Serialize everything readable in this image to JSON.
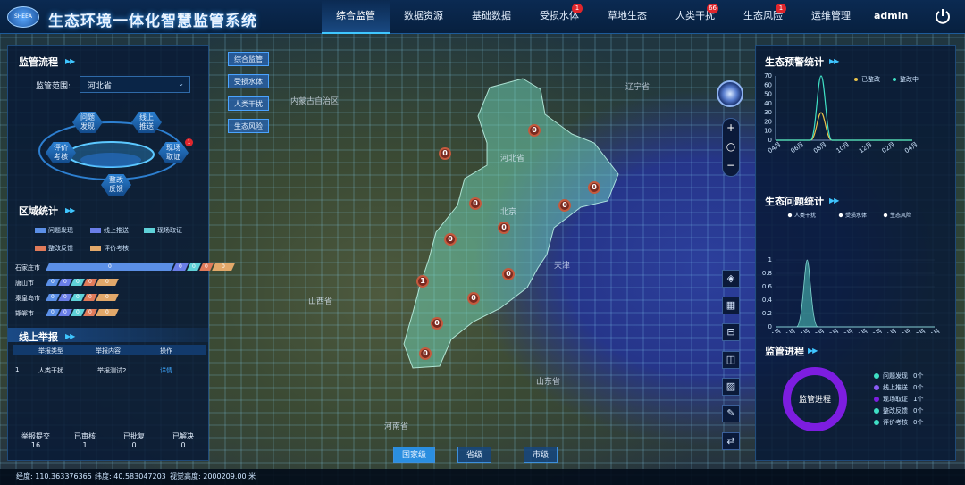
{
  "header": {
    "logo_text": "SHEEA",
    "title": "生态环境一体化智慧监管系统",
    "user": "admin",
    "nav": [
      {
        "label": "综合监管",
        "badge": ""
      },
      {
        "label": "数据资源",
        "badge": ""
      },
      {
        "label": "基础数据",
        "badge": ""
      },
      {
        "label": "受损水体",
        "badge": "1"
      },
      {
        "label": "草地生态",
        "badge": ""
      },
      {
        "label": "人类干扰",
        "badge": "66"
      },
      {
        "label": "生态风险",
        "badge": "1"
      },
      {
        "label": "运维管理",
        "badge": ""
      }
    ]
  },
  "left": {
    "process_title": "监管流程",
    "scope_label": "监管范围:",
    "scope_value": "河北省",
    "process_nodes": [
      {
        "label": "问题\n发现"
      },
      {
        "label": "线上\n推送"
      },
      {
        "label": "评价\n考核"
      },
      {
        "label": "现场\n取证",
        "badge": "1"
      },
      {
        "label": "整改\n反馈"
      }
    ],
    "region_title": "区域统计",
    "legend": [
      {
        "label": "问题发现",
        "color": "#5b8fe6"
      },
      {
        "label": "线上推送",
        "color": "#6a7ee8"
      },
      {
        "label": "现场取证",
        "color": "#5fd1d8"
      },
      {
        "label": "整改反馈",
        "color": "#e07b5a"
      },
      {
        "label": "评价考核",
        "color": "#e2a86a"
      }
    ],
    "region_rows": [
      {
        "name": "石家庄市",
        "segs": [
          "0",
          "0",
          "0",
          "0",
          "0"
        ]
      },
      {
        "name": "唐山市",
        "segs": [
          "0",
          "0",
          "0",
          "0",
          "0"
        ]
      },
      {
        "name": "秦皇岛市",
        "segs": [
          "0",
          "0",
          "0",
          "0",
          "0"
        ]
      },
      {
        "name": "邯郸市",
        "segs": [
          "0",
          "0",
          "0",
          "0",
          "0"
        ]
      }
    ],
    "report_title": "线上举报",
    "report_headers": [
      "举报类型",
      "举报内容",
      "操作"
    ],
    "report_rows": [
      {
        "index": "1",
        "type": "人类干扰",
        "content": "举报测试2",
        "action": "详情"
      }
    ],
    "stats": [
      {
        "label": "举报提交",
        "value": "16"
      },
      {
        "label": "已审核",
        "value": "1"
      },
      {
        "label": "已批复",
        "value": "0"
      },
      {
        "label": "已解决",
        "value": "0"
      }
    ]
  },
  "map": {
    "side_tabs": [
      "综合监管",
      "受损水体",
      "人类干扰",
      "生态风险"
    ],
    "labels": [
      "内蒙古自治区",
      "河北省",
      "北京",
      "天津",
      "山西省",
      "山东省",
      "河南省",
      "辽宁省"
    ],
    "counts": [
      "0",
      "0",
      "0",
      "0",
      "0",
      "0",
      "0",
      "0",
      "1",
      "0",
      "0",
      "0",
      "0"
    ],
    "level_tabs": [
      "国家级",
      "省级",
      "市级"
    ],
    "zoom": [
      "+",
      "○",
      "−"
    ],
    "tools": [
      {
        "name": "layers-icon",
        "glyph": "◈"
      },
      {
        "name": "grid-icon",
        "glyph": "▦"
      },
      {
        "name": "measure-icon",
        "glyph": "⊟"
      },
      {
        "name": "split-icon",
        "glyph": "◫"
      },
      {
        "name": "hatch-icon",
        "glyph": "▨"
      },
      {
        "name": "draw-icon",
        "glyph": "✎"
      },
      {
        "name": "swap-icon",
        "glyph": "⇄"
      }
    ]
  },
  "status": {
    "lon": "经度: 110.363376365",
    "lat": "纬度: 40.583047203",
    "alt": "视觉高度: 2000209.00 米"
  },
  "right": {
    "warn_title": "生态预警统计",
    "issue_title": "生态问题统计",
    "progress_title": "监管进程",
    "donut_text": "监管进程",
    "progress_items": [
      {
        "label": "问题发现",
        "value": "0个",
        "color": "#3fe0c5"
      },
      {
        "label": "线上推送",
        "value": "0个",
        "color": "#8b5cf6"
      },
      {
        "label": "现场取证",
        "value": "1个",
        "color": "#7d1de0"
      },
      {
        "label": "整改反馈",
        "value": "0个",
        "color": "#3fe0c5"
      },
      {
        "label": "评价考核",
        "value": "0个",
        "color": "#3fe0c5"
      }
    ]
  },
  "chart_data": [
    {
      "type": "line",
      "title": "生态预警统计",
      "categories": [
        "04月",
        "06月",
        "08月",
        "10月",
        "12月",
        "02月",
        "04月"
      ],
      "series": [
        {
          "name": "已整改",
          "color": "#e8c24a",
          "values": [
            0,
            0,
            30,
            0,
            0,
            0,
            0
          ]
        },
        {
          "name": "整改中",
          "color": "#3fe0c5",
          "values": [
            0,
            0,
            70,
            0,
            0,
            0,
            0
          ]
        }
      ],
      "ylim": [
        0,
        70
      ],
      "yticks": [
        0,
        10,
        20,
        30,
        40,
        50,
        60,
        70
      ]
    },
    {
      "type": "area",
      "title": "生态问题统计",
      "categories": [
        "04月",
        "05月",
        "07月",
        "08月",
        "09月",
        "10月",
        "11月",
        "12月",
        "01月",
        "02月",
        "03月",
        "04月"
      ],
      "series": [
        {
          "name": "人类干扰",
          "color": "#ffffff",
          "values": [
            0,
            0,
            1,
            0,
            0,
            0,
            0,
            0,
            0,
            0,
            0,
            0
          ]
        },
        {
          "name": "受损水体",
          "color": "#ffffff",
          "values": [
            0,
            0,
            0,
            0,
            0,
            0,
            0,
            0,
            0,
            0,
            0,
            0
          ]
        },
        {
          "name": "生态风险",
          "color": "#ffffff",
          "values": [
            0,
            0,
            0,
            0,
            0,
            0,
            0,
            0,
            0,
            0,
            0,
            0
          ]
        }
      ],
      "ylim": [
        0,
        1
      ],
      "yticks": [
        0,
        0.2,
        0.4,
        0.6,
        0.8,
        1
      ]
    }
  ]
}
